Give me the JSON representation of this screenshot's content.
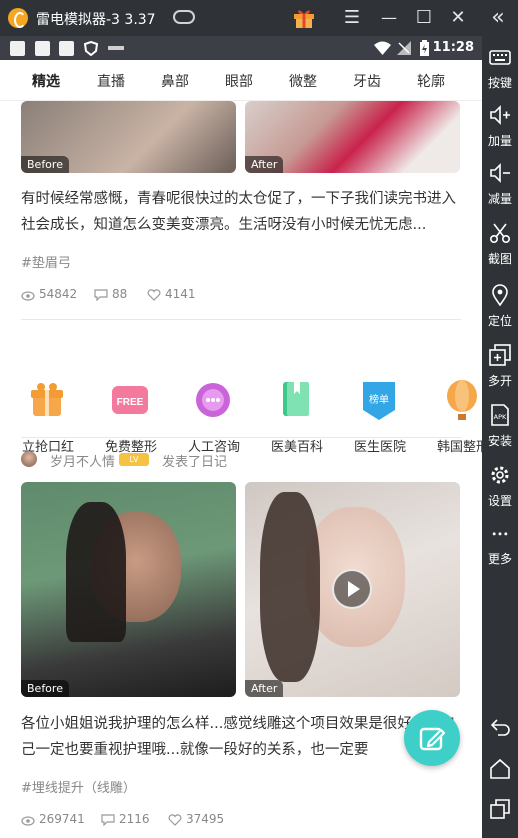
{
  "window": {
    "title": "雷电模拟器-3 3.37",
    "minimize": "—",
    "maximize": "☐",
    "close": "✕",
    "menu": "☰",
    "collapse": "«"
  },
  "statusbar": {
    "time": "11:28"
  },
  "tabs": [
    "精选",
    "直播",
    "鼻部",
    "眼部",
    "微整",
    "牙齿",
    "轮廓"
  ],
  "post1": {
    "before_label": "Before",
    "after_label": "After",
    "description": "有时候经常感慨，青春呢很快过的太仓促了，一下子我们读完书进入社会成长，知道怎么变美变漂亮。生活呀没有小时候无忧无虑...",
    "tag": "#垫眉弓",
    "views": "54842",
    "comments": "88",
    "likes": "4141"
  },
  "quick_links": [
    "立抢口红",
    "免费整形",
    "人工咨询",
    "医美百科",
    "医生医院",
    "韩国整形"
  ],
  "post2": {
    "username": "岁月不人情",
    "action": "发表了日记",
    "badge": "LV",
    "before_label": "Before",
    "after_label": "After",
    "description": "各位小姐姐说我护理的怎么样...感觉线雕这个项目效果是很好，但自己一定也要重视护理哦...就像一段好的关系，也一定要",
    "tag": "#埋线提升（线雕）",
    "views": "269741",
    "comments": "2116",
    "likes": "37495"
  },
  "sidebar": {
    "items": [
      "按键",
      "加量",
      "减量",
      "截图",
      "定位",
      "多开",
      "安装",
      "设置",
      "更多"
    ]
  },
  "colors": {
    "accent": "#3ed0c8",
    "emulator_bg": "#2f3338"
  }
}
